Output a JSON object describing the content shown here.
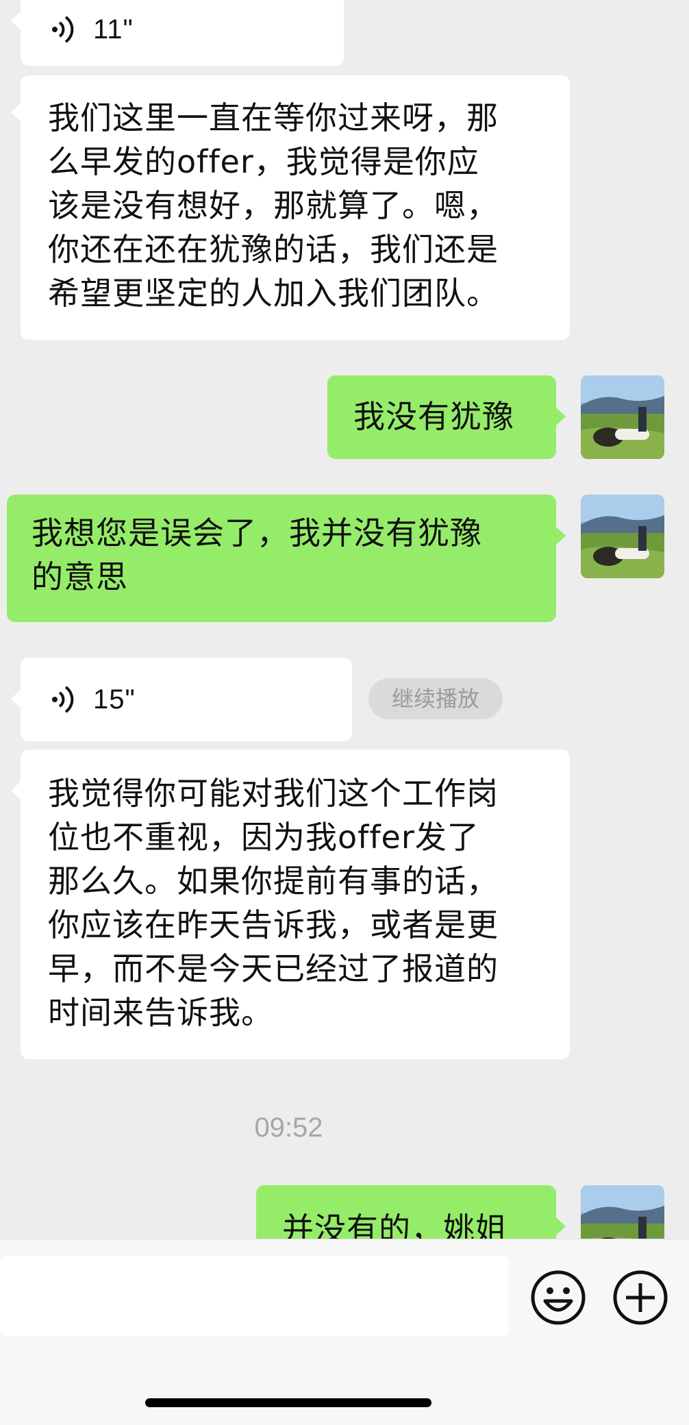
{
  "messages": [
    {
      "kind": "voice",
      "side": "in",
      "duration": "11\""
    },
    {
      "kind": "text",
      "side": "in",
      "lines": [
        "我们这里一直在等你过来呀，那",
        "么早发的offer，我觉得是你应",
        "该是没有想好，那就算了。嗯，",
        "你还在还在犹豫的话，我们还是",
        "希望更坚定的人加入我们团队。"
      ]
    },
    {
      "kind": "text",
      "side": "out",
      "lines": [
        "我没有犹豫"
      ]
    },
    {
      "kind": "text",
      "side": "out",
      "lines": [
        "我想您是误会了，我并没有犹豫",
        "的意思"
      ]
    },
    {
      "kind": "voice",
      "side": "in",
      "duration": "15\"",
      "action_label": "继续播放"
    },
    {
      "kind": "text",
      "side": "in",
      "lines": [
        "我觉得你可能对我们这个工作岗",
        "位也不重视，因为我offer发了",
        "那么久。如果你提前有事的话，",
        "你应该在昨天告诉我，或者是更",
        "早，而不是今天已经过了报道的",
        "时间来告诉我。"
      ]
    },
    {
      "kind": "text",
      "side": "out",
      "lines": [
        "并没有的，姚姐"
      ]
    }
  ],
  "timestamp": "09:52",
  "input_bar": {
    "emoji_icon": "smiley-icon",
    "plus_icon": "plus-circle-icon"
  },
  "colors": {
    "background": "#ededed",
    "incoming_bubble": "#ffffff",
    "outgoing_bubble": "#95ec69"
  }
}
